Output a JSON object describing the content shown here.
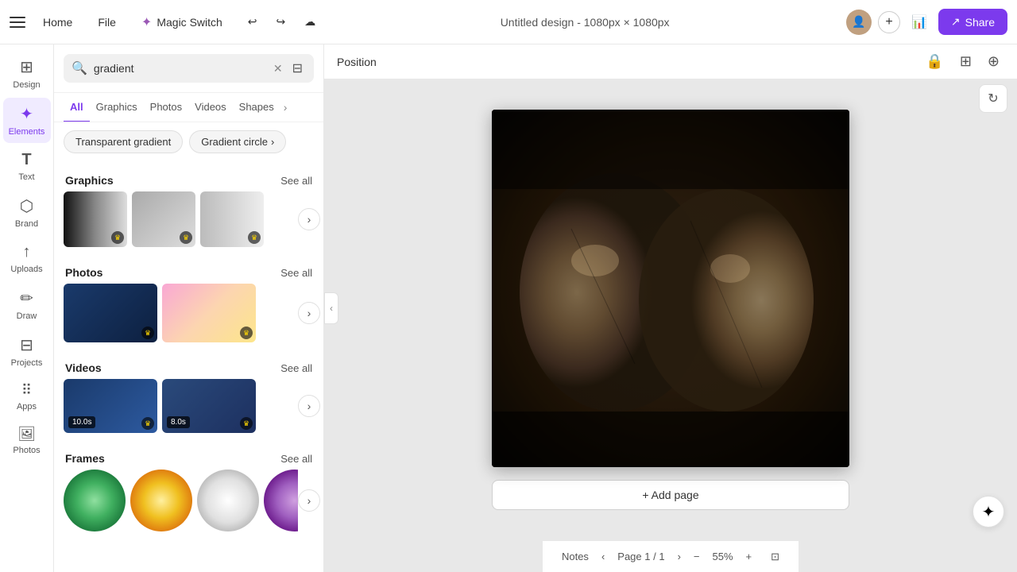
{
  "topNav": {
    "homeLabel": "Home",
    "fileLabel": "File",
    "magicSwitchLabel": "Magic Switch",
    "docTitle": "Untitled design - 1080px × 1080px",
    "shareLabel": "Share"
  },
  "sidebar": {
    "items": [
      {
        "id": "design",
        "label": "Design",
        "icon": "⊞"
      },
      {
        "id": "elements",
        "label": "Elements",
        "icon": "✦",
        "active": true
      },
      {
        "id": "text",
        "label": "Text",
        "icon": "T"
      },
      {
        "id": "brand",
        "label": "Brand",
        "icon": "⬡"
      },
      {
        "id": "uploads",
        "label": "Uploads",
        "icon": "↑"
      },
      {
        "id": "draw",
        "label": "Draw",
        "icon": "✏"
      },
      {
        "id": "projects",
        "label": "Projects",
        "icon": "⊟"
      },
      {
        "id": "apps",
        "label": "Apps",
        "icon": "⠿"
      },
      {
        "id": "photos",
        "label": "Photos",
        "icon": "🖼"
      }
    ]
  },
  "panel": {
    "searchValue": "gradient",
    "tabs": [
      {
        "id": "all",
        "label": "All",
        "active": true
      },
      {
        "id": "graphics",
        "label": "Graphics",
        "active": false
      },
      {
        "id": "photos",
        "label": "Photos",
        "active": false
      },
      {
        "id": "videos",
        "label": "Videos",
        "active": false
      },
      {
        "id": "shapes",
        "label": "Shapes",
        "active": false
      }
    ],
    "suggestions": [
      {
        "id": "transparent-gradient",
        "label": "Transparent gradient"
      },
      {
        "id": "gradient-circle",
        "label": "Gradient circle"
      }
    ],
    "sections": {
      "graphics": {
        "title": "Graphics",
        "seeAllLabel": "See all"
      },
      "photos": {
        "title": "Photos",
        "seeAllLabel": "See all"
      },
      "videos": {
        "title": "Videos",
        "seeAllLabel": "See all",
        "items": [
          {
            "duration": "10.0s"
          },
          {
            "duration": "8.0s"
          }
        ]
      },
      "frames": {
        "title": "Frames",
        "seeAllLabel": "See all"
      }
    }
  },
  "canvas": {
    "positionLabel": "Position",
    "addPageLabel": "+ Add page"
  },
  "bottomBar": {
    "notesLabel": "Notes",
    "pageIndicator": "Page  1 / 1",
    "zoomLevel": "55%"
  }
}
